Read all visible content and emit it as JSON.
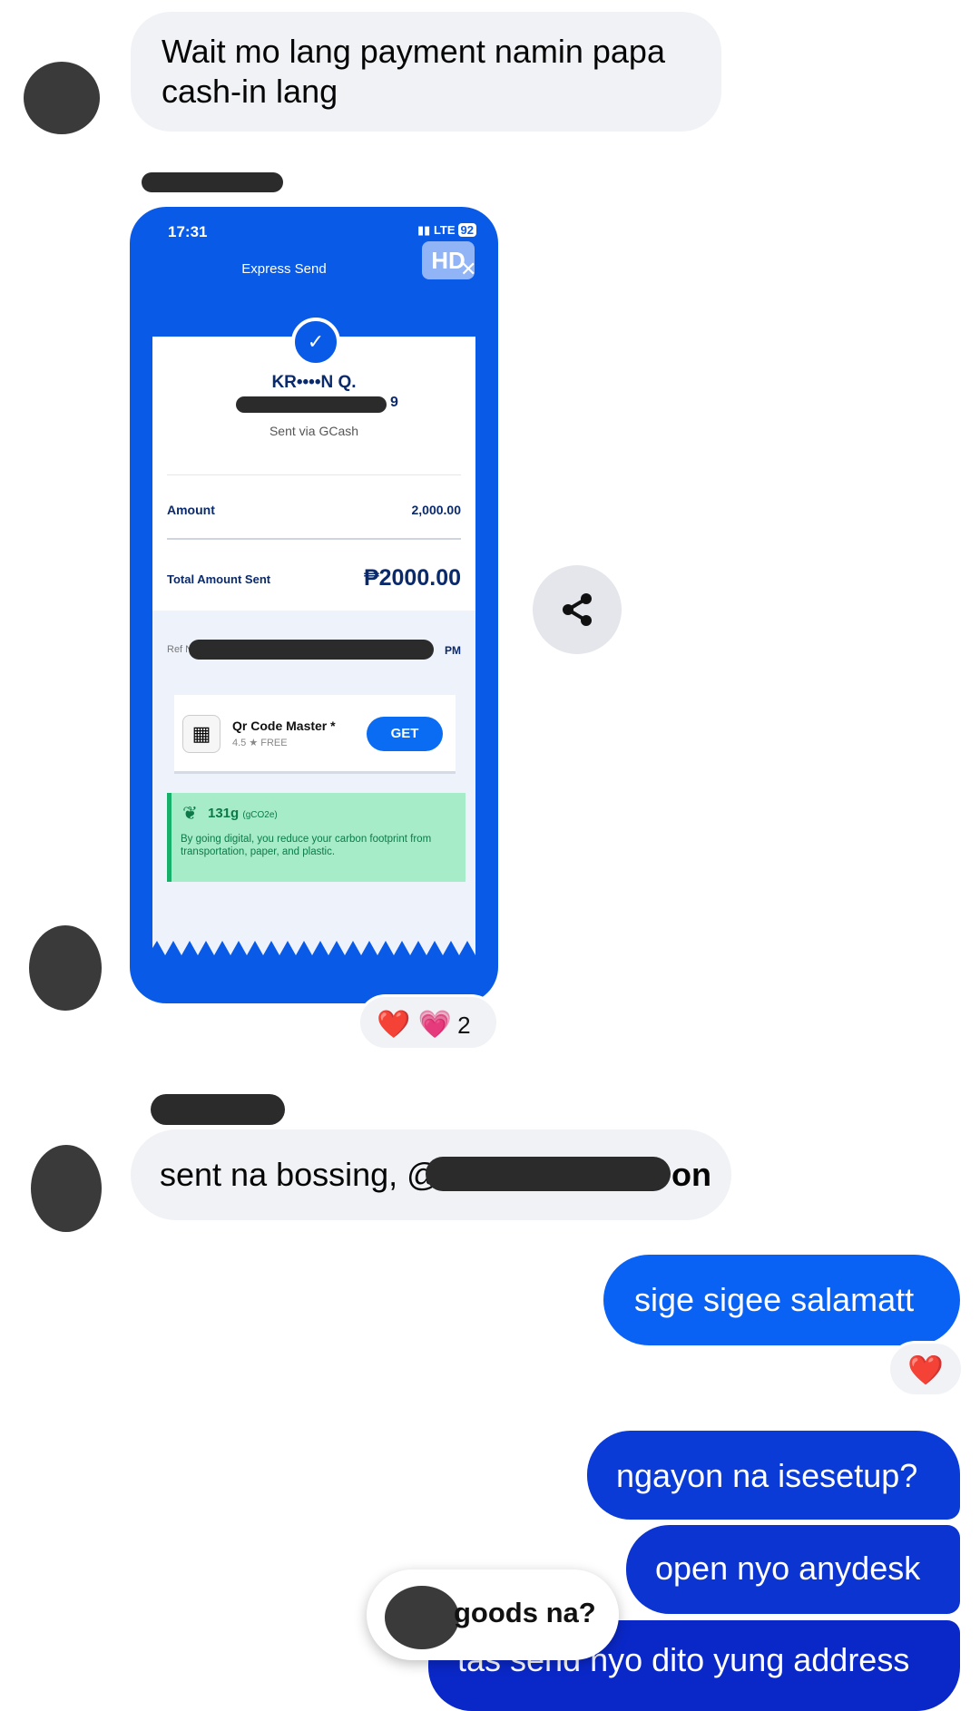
{
  "messages": {
    "m1": "Wait mo lang payment namin papa cash-in lang",
    "m2_prefix": "sent na bossing, @",
    "m2_suffix": "on",
    "m3": "sige sigee salamatt",
    "m4": "ngayon na isesetup?",
    "m5": "open nyo anydesk",
    "m6": "tas send nyo dito yung address",
    "overlay": "goods na?"
  },
  "receipt": {
    "time": "17:31",
    "network": "LTE",
    "battery": "92",
    "hd_badge": "HD",
    "screen_title": "Express Send",
    "recipient": "KR••••N Q.",
    "recipient_number_tail": "9",
    "sent_via": "Sent via GCash",
    "amount_label": "Amount",
    "amount_value": "2,000.00",
    "total_label": "Total Amount Sent",
    "total_value": "₱2000.00",
    "ref_label": "Ref N",
    "ref_time_tail": "PM",
    "ad_name": "Qr Code Master *",
    "ad_meta": "4.5 ★  FREE",
    "ad_button": "GET",
    "carbon_value": "131g",
    "carbon_unit": "(gCO2e)",
    "carbon_text": "By going digital, you reduce your carbon footprint from transportation, paper, and plastic."
  },
  "reactions": {
    "photo_count": "2",
    "photo_emojis": [
      "❤️",
      "💗"
    ],
    "msg3_emoji": "❤️"
  },
  "icons": [
    "share-icon",
    "check-icon",
    "leaf-icon",
    "qr-icon",
    "close-icon"
  ],
  "colors": {
    "incoming_bg": "#f0f2f5",
    "outgoing_blue": "#0a62f5",
    "outgoing_indigo": "#0b32cf",
    "gcash_blue": "#0a5ae8"
  }
}
